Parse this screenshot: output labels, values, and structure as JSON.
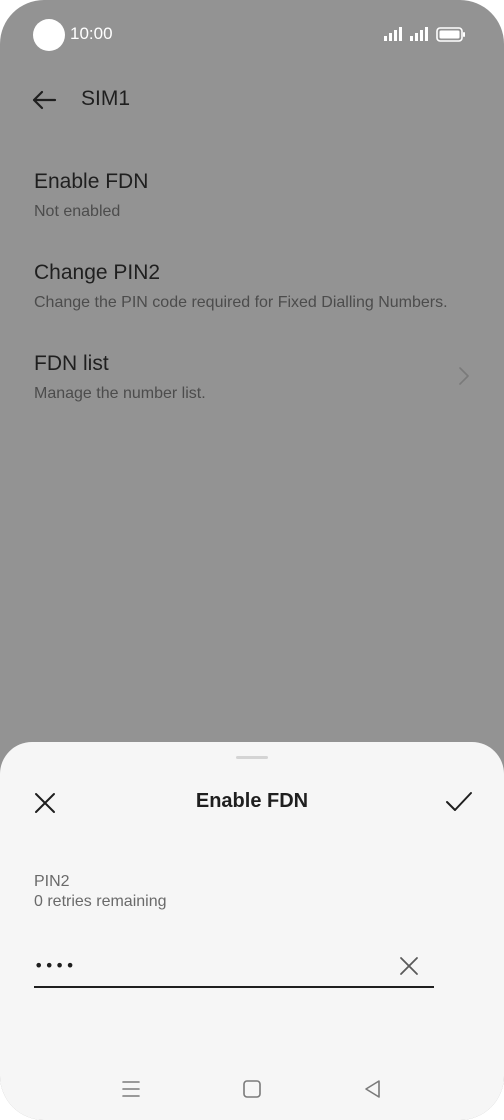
{
  "status_bar": {
    "time": "10:00",
    "icons": [
      "signal-sim1-icon",
      "signal-sim2-icon",
      "battery-icon"
    ]
  },
  "header": {
    "title": "SIM1",
    "back_icon": "back-arrow-icon"
  },
  "settings": {
    "items": [
      {
        "title": "Enable FDN",
        "subtitle": "Not enabled"
      },
      {
        "title": "Change PIN2",
        "subtitle": "Change the PIN code required for Fixed Dialling Numbers."
      },
      {
        "title": "FDN list",
        "subtitle": "Manage the number list.",
        "icon": "chevron-right-icon"
      }
    ]
  },
  "dialog": {
    "title": "Enable FDN",
    "close_icon": "close-icon",
    "confirm_icon": "check-icon",
    "field_label": "PIN2",
    "field_hint": "0 retries remaining",
    "input_value": "••••",
    "clear_icon": "clear-icon"
  },
  "nav_bar": {
    "icons": [
      "menu-icon",
      "home-icon",
      "back-triangle-icon"
    ]
  },
  "colors": {
    "scrim_background": "#939393",
    "sheet_background": "#f6f6f6",
    "text_primary": "#1f1f1f",
    "text_secondary": "#4c4c4c"
  }
}
